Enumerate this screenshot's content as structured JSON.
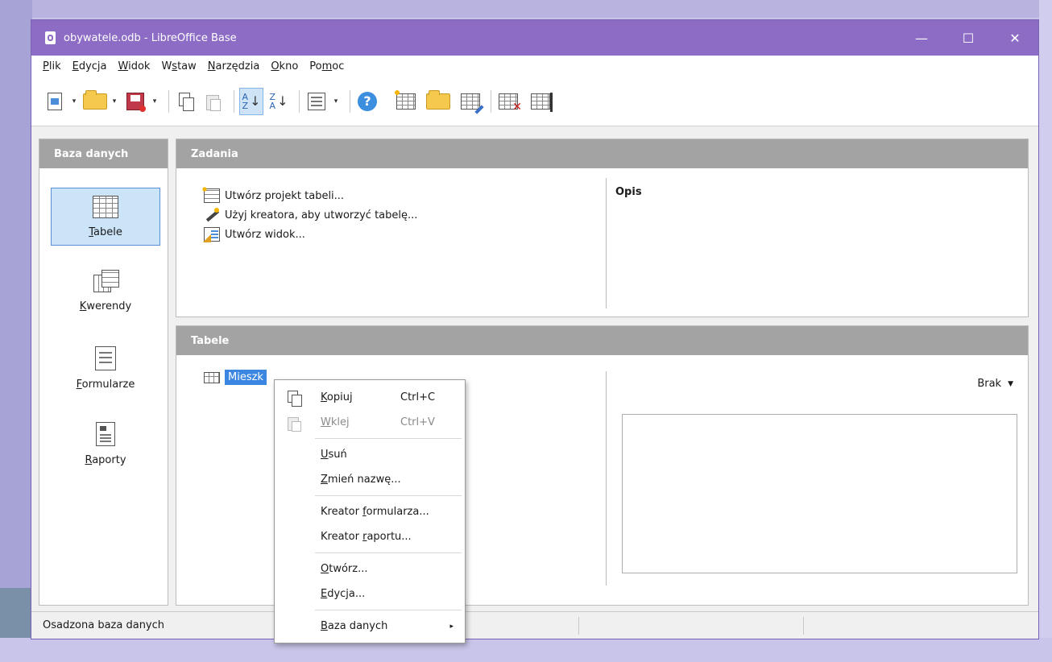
{
  "window": {
    "title": "obywatele.odb - LibreOffice Base",
    "minimize": "—",
    "maximize": "☐",
    "close": "✕"
  },
  "menu": [
    {
      "pre": "",
      "key": "P",
      "post": "lik"
    },
    {
      "pre": "",
      "key": "E",
      "post": "dycja"
    },
    {
      "pre": "",
      "key": "W",
      "post": "idok"
    },
    {
      "pre": "W",
      "key": "s",
      "post": "taw"
    },
    {
      "pre": "",
      "key": "N",
      "post": "arzędzia"
    },
    {
      "pre": "",
      "key": "O",
      "post": "kno"
    },
    {
      "pre": "Po",
      "key": "m",
      "post": "oc"
    }
  ],
  "toolbar": {
    "help_glyph": "?",
    "sort_asc": {
      "top": "A",
      "bottom": "Z",
      "arrow": "↓"
    },
    "sort_desc": {
      "top": "Z",
      "bottom": "A",
      "arrow": "↓"
    },
    "dropdown_glyph": "▾"
  },
  "sidebar": {
    "title": "Baza danych",
    "items": [
      {
        "key": "T",
        "rest": "abele",
        "selected": true
      },
      {
        "key": "K",
        "rest": "werendy",
        "selected": false
      },
      {
        "key": "F",
        "rest": "ormularze",
        "selected": false
      },
      {
        "key": "R",
        "rest": "aporty",
        "selected": false
      }
    ]
  },
  "tasks": {
    "title": "Zadania",
    "items": [
      {
        "label": "Utwórz projekt tabeli..."
      },
      {
        "label": "Użyj kreatora, aby utworzyć tabelę..."
      },
      {
        "label": "Utwórz widok..."
      }
    ],
    "description_label": "Opis"
  },
  "tables": {
    "title": "Tabele",
    "entries": [
      {
        "label": "Mieszk"
      }
    ],
    "preview_mode": "Brak",
    "preview_caret": "▼"
  },
  "context_menu": {
    "copy": {
      "key": "K",
      "rest": "opiuj",
      "shortcut": "Ctrl+C"
    },
    "paste": {
      "key": "W",
      "rest": "klej",
      "shortcut": "Ctrl+V"
    },
    "delete": {
      "key": "U",
      "rest": "suń"
    },
    "rename": {
      "key": "Z",
      "rest": "mień nazwę..."
    },
    "form_wizard": {
      "pre": "Kreator ",
      "key": "f",
      "rest": "ormularza..."
    },
    "report_wizard": {
      "pre": "Kreator ",
      "key": "r",
      "rest": "aportu..."
    },
    "open": {
      "key": "O",
      "rest": "twórz..."
    },
    "edit": {
      "key": "E",
      "rest": "dycja..."
    },
    "database": {
      "key": "B",
      "rest": "aza danych",
      "arrow": "▸"
    }
  },
  "status": {
    "text": "Osadzona baza danych"
  },
  "colors": {
    "titlebar": "#8d6cc6",
    "selection": "#3b86e0",
    "panel_header": "#a3a3a3"
  }
}
